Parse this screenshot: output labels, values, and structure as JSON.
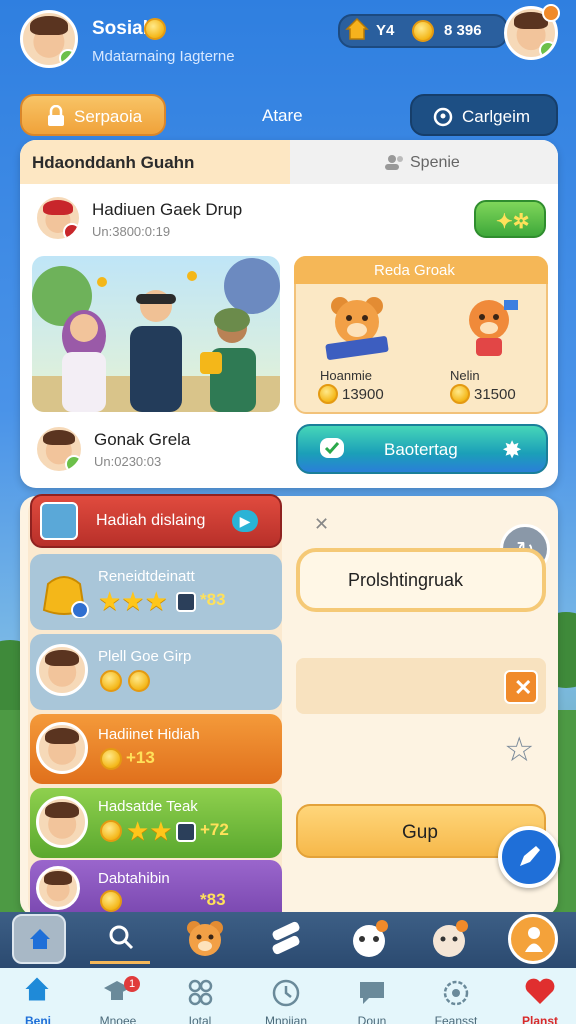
{
  "header": {
    "username": "Sosial",
    "subtitle": "Mdatarnaing Iagterne",
    "stat_label": "Y4",
    "coin_count": "8 396"
  },
  "tabs": [
    {
      "label": "Serpaoia"
    },
    {
      "label": "Atare"
    },
    {
      "label": "Carlgeim"
    }
  ],
  "card": {
    "section_tabs": [
      "Hdaonddanh Guahn",
      "Spenie"
    ],
    "group": {
      "name": "Hadiuen Gaek Drup",
      "meta": "Un:3800:0:19"
    },
    "reward_panel": {
      "title": "Reda Groak",
      "items": [
        {
          "label": "Hoanmie",
          "value": "13900"
        },
        {
          "label": "Nelin",
          "value": "31500"
        }
      ]
    },
    "member": {
      "name": "Gonak Grela",
      "meta": "Un:0230:03"
    },
    "action_label": "Baotertag"
  },
  "list": {
    "header": "Hadiah dislaing",
    "items": [
      {
        "title": "Reneidtdeinatt",
        "value": "*83",
        "color": "#9fbcd0"
      },
      {
        "title": "Plell Goe Girp",
        "value": "",
        "color": "#9fbcd0"
      },
      {
        "title": "Hadiinet Hidiah",
        "value": "+13",
        "color": "#f08a2a"
      },
      {
        "title": "Hadsatde Teak",
        "value": "+72",
        "color": "#7cc23e"
      },
      {
        "title": "Dabtahibin",
        "value": "*83",
        "color": "#8a5ac0"
      }
    ]
  },
  "right_panel": {
    "input_label": "Prolshtingruak",
    "action_label": "Gup"
  },
  "bottom_tabs": [
    {
      "label": "Beni"
    },
    {
      "label": "Mnoee"
    },
    {
      "label": "Iotal"
    },
    {
      "label": "Mnpiian"
    },
    {
      "label": "Doun"
    },
    {
      "label": "Feansst"
    },
    {
      "label": "Planst"
    }
  ],
  "notification_badge": "1",
  "colors": {
    "accent_orange": "#f3a23b",
    "navy": "#1d4f84",
    "green": "#4caf3a"
  }
}
